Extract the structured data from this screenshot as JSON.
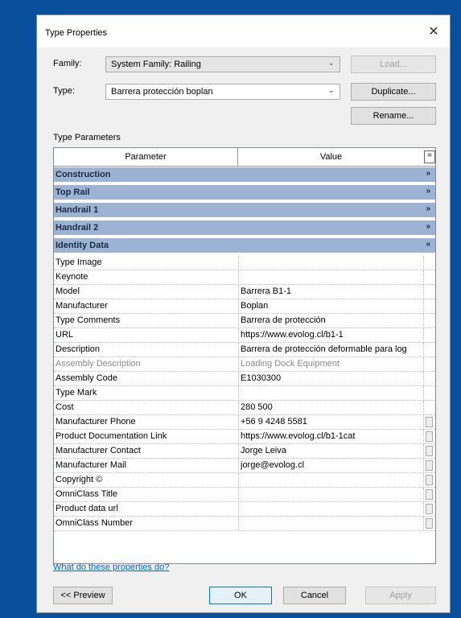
{
  "window": {
    "title": "Type Properties",
    "close_glyph": "✕"
  },
  "family": {
    "label": "Family:",
    "value": "System Family: Railing"
  },
  "type": {
    "label": "Type:",
    "value": "Barrera protección boplan"
  },
  "buttons": {
    "load": "Load...",
    "duplicate": "Duplicate...",
    "rename": "Rename..."
  },
  "section_title": "Type Parameters",
  "table": {
    "col_parameter": "Parameter",
    "col_value": "Value",
    "col_toggle": "="
  },
  "groups": [
    {
      "name": "Construction",
      "chevron": "»"
    },
    {
      "name": "Top Rail",
      "chevron": "»"
    },
    {
      "name": "Handrail 1",
      "chevron": "»"
    },
    {
      "name": "Handrail 2",
      "chevron": "»"
    },
    {
      "name": "Identity Data",
      "chevron": "«"
    }
  ],
  "rows": [
    {
      "parameter": "Type Image",
      "value": ""
    },
    {
      "parameter": "Keynote",
      "value": ""
    },
    {
      "parameter": "Model",
      "value": "Barrera B1-1"
    },
    {
      "parameter": "Manufacturer",
      "value": "Boplan"
    },
    {
      "parameter": "Type Comments",
      "value": "Barrera de protección"
    },
    {
      "parameter": "URL",
      "value": "https://www.evolog.cl/b1-1"
    },
    {
      "parameter": "Description",
      "value": "Barrera de protección deformable para log"
    },
    {
      "parameter": "Assembly Description",
      "value": "Loading Dock Equipment"
    },
    {
      "parameter": "Assembly Code",
      "value": "E1030300"
    },
    {
      "parameter": "Type Mark",
      "value": ""
    },
    {
      "parameter": "Cost",
      "value": "280 500"
    },
    {
      "parameter": "Manufacturer Phone",
      "value": "+56 9 4248 5581"
    },
    {
      "parameter": "Product Documentation Link",
      "value": "https://www.evolog.cl/b1-1cat"
    },
    {
      "parameter": "Manufacturer  Contact",
      "value": "Jorge Leiva"
    },
    {
      "parameter": "Manufacturer  Mail",
      "value": "jorge@evolog.cl"
    },
    {
      "parameter": "Copyright ©",
      "value": ""
    },
    {
      "parameter": "OmniClass Title",
      "value": ""
    },
    {
      "parameter": "Product data url",
      "value": ""
    },
    {
      "parameter": "OmniClass Number",
      "value": ""
    }
  ],
  "help_link": "What do these properties do?",
  "footer": {
    "preview": "<< Preview",
    "ok": "OK",
    "cancel": "Cancel",
    "apply": "Apply"
  },
  "colors": {
    "frame": "#0a4f9c",
    "group_band": "#9cb3d3",
    "link": "#0066cc"
  }
}
